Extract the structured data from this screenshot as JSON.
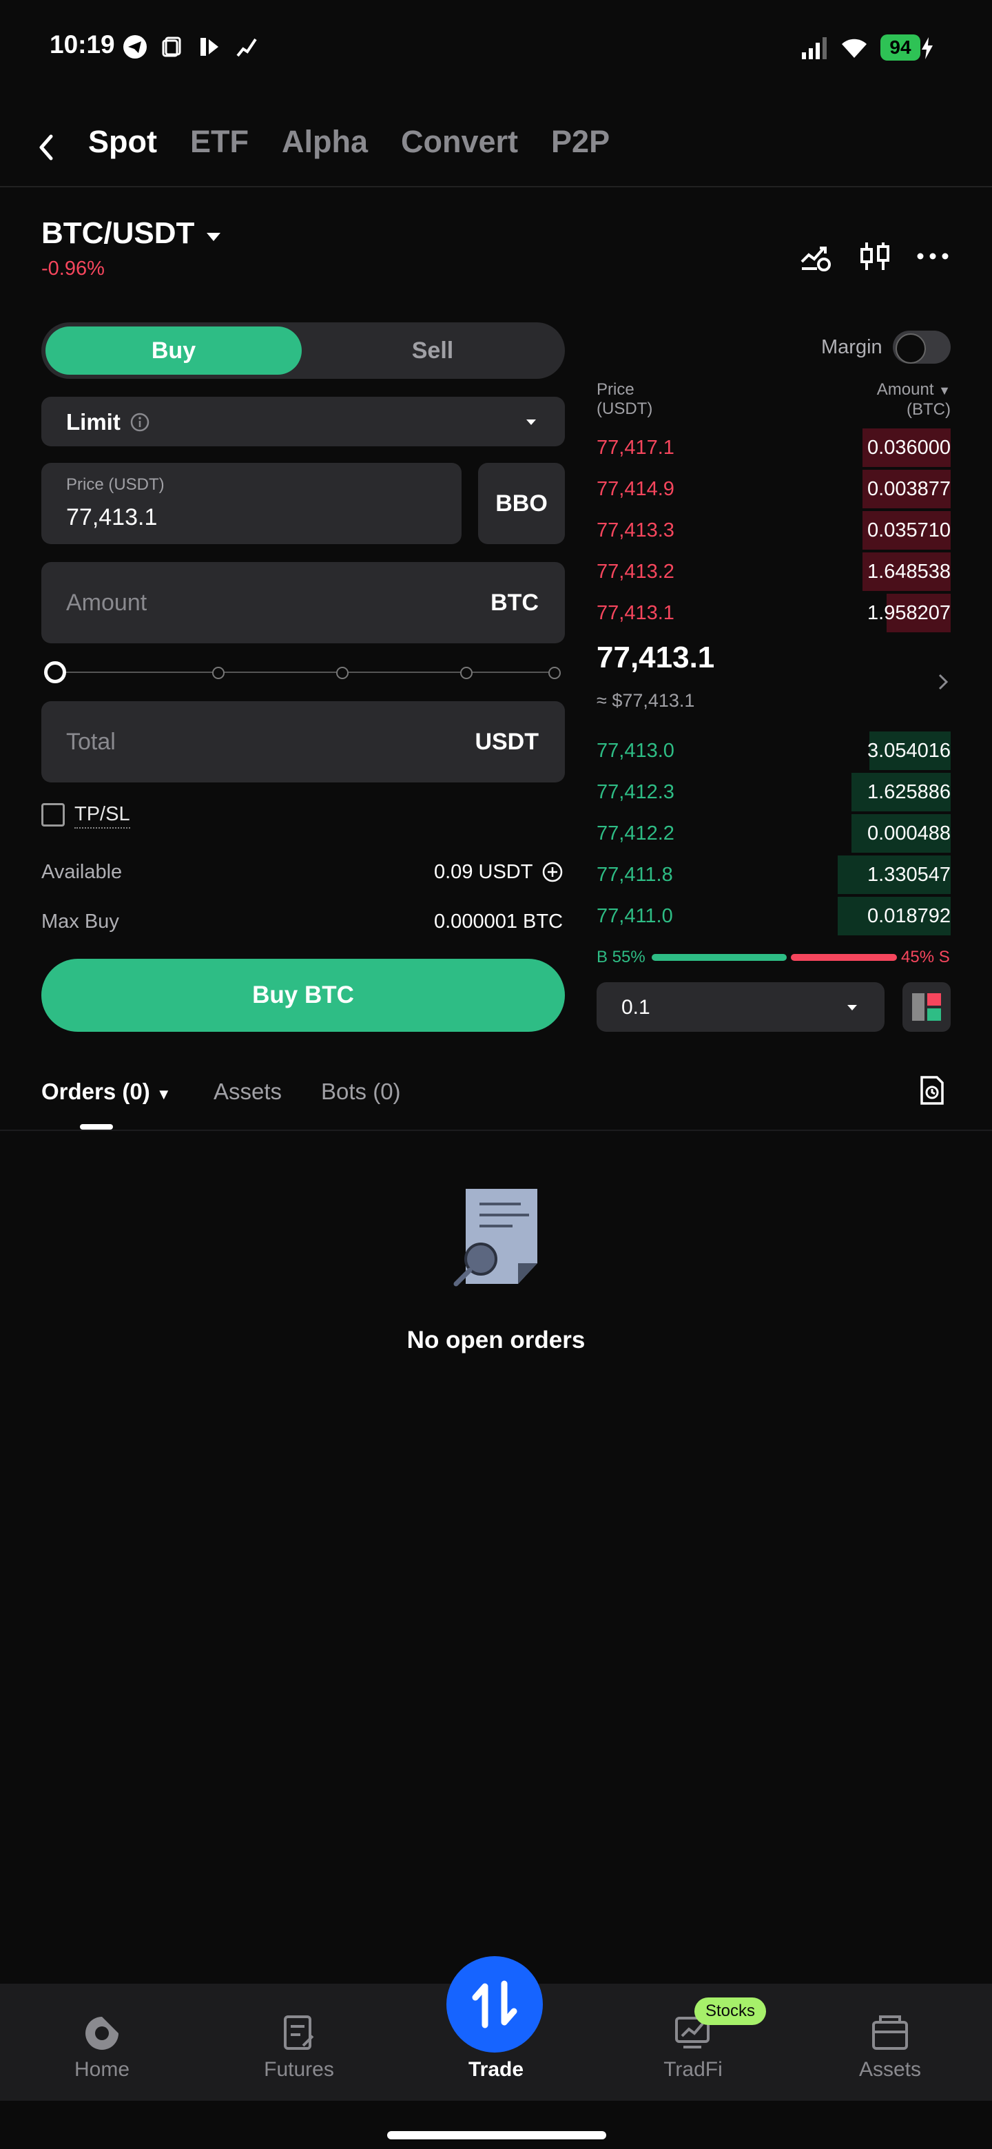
{
  "status_bar": {
    "time": "10:19",
    "battery": "94"
  },
  "nav": {
    "tabs": [
      "Spot",
      "ETF",
      "Alpha",
      "Convert",
      "P2P"
    ],
    "active": "Spot"
  },
  "pair": {
    "name": "BTC/USDT",
    "change": "-0.96%"
  },
  "trade_form": {
    "buy_label": "Buy",
    "sell_label": "Sell",
    "order_type": "Limit",
    "price_caption": "Price (USDT)",
    "price_value": "77,413.1",
    "bbo_label": "BBO",
    "amount_placeholder": "Amount",
    "amount_unit": "BTC",
    "slider_percent": 0,
    "total_placeholder": "Total",
    "total_unit": "USDT",
    "tpsl_label": "TP/SL",
    "available_label": "Available",
    "available_value": "0.09 USDT",
    "max_buy_label": "Max Buy",
    "max_buy_value": "0.000001 BTC",
    "submit_label": "Buy BTC"
  },
  "order_book": {
    "margin_label": "Margin",
    "price_header": [
      "Price",
      "(USDT)"
    ],
    "amount_header": [
      "Amount",
      "(BTC)"
    ],
    "asks": [
      {
        "price": "77,417.1",
        "amount": "0.036000",
        "depth": 0.25
      },
      {
        "price": "77,414.9",
        "amount": "0.003877",
        "depth": 0.25
      },
      {
        "price": "77,413.3",
        "amount": "0.035710",
        "depth": 0.25
      },
      {
        "price": "77,413.2",
        "amount": "1.648538",
        "depth": 0.25
      },
      {
        "price": "77,413.1",
        "amount": "1.958207",
        "depth": 0.18
      }
    ],
    "last_price": "77,413.1",
    "last_price_fiat": "≈ $77,413.1",
    "bids": [
      {
        "price": "77,413.0",
        "amount": "3.054016",
        "depth": 0.23
      },
      {
        "price": "77,412.3",
        "amount": "1.625886",
        "depth": 0.28
      },
      {
        "price": "77,412.2",
        "amount": "0.000488",
        "depth": 0.28
      },
      {
        "price": "77,411.8",
        "amount": "1.330547",
        "depth": 0.32
      },
      {
        "price": "77,411.0",
        "amount": "0.018792",
        "depth": 0.32
      }
    ],
    "buy_ratio": "B 55%",
    "sell_ratio": "45% S",
    "depth_step": "0.1"
  },
  "orders": {
    "tabs": [
      "Orders (0)",
      "Assets",
      "Bots (0)"
    ],
    "empty_text": "No open orders"
  },
  "bottom_nav": {
    "items": [
      "Home",
      "Futures",
      "Trade",
      "TradFi",
      "Assets"
    ],
    "active": "Trade",
    "badge": "Stocks"
  },
  "colors": {
    "buy": "#2ebd85",
    "sell": "#f6465d",
    "accent": "#1664ff",
    "badge": "#a6f06a"
  }
}
